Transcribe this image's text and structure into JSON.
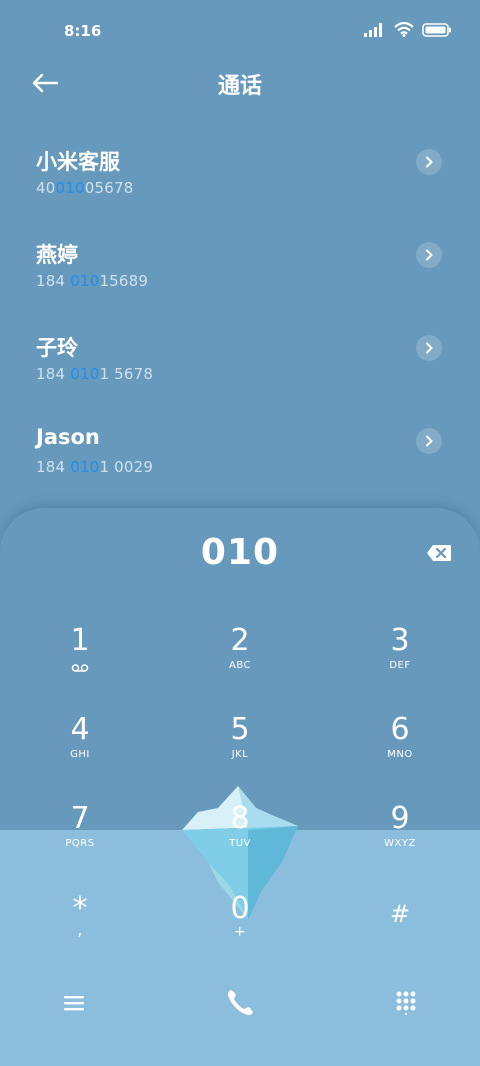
{
  "status": {
    "time": "8:16"
  },
  "header": {
    "title": "通话"
  },
  "contacts": [
    {
      "name": "小米客服",
      "num_pre": "40",
      "num_hl": "010",
      "num_post": "05678"
    },
    {
      "name": "燕婷",
      "num_pre": "184 ",
      "num_hl": "010",
      "num_post": "15689"
    },
    {
      "name": "子玲",
      "num_pre": "184 ",
      "num_hl": "010",
      "num_post": "1 5678"
    },
    {
      "name": "Jason",
      "num_pre": "184 ",
      "num_hl": "010",
      "num_post": "1 0029"
    }
  ],
  "dialpad": {
    "input": "010",
    "keys": [
      {
        "digit": "1",
        "letters": ""
      },
      {
        "digit": "2",
        "letters": "ABC"
      },
      {
        "digit": "3",
        "letters": "DEF"
      },
      {
        "digit": "4",
        "letters": "GHI"
      },
      {
        "digit": "5",
        "letters": "JKL"
      },
      {
        "digit": "6",
        "letters": "MNO"
      },
      {
        "digit": "7",
        "letters": "PQRS"
      },
      {
        "digit": "8",
        "letters": "TUV"
      },
      {
        "digit": "9",
        "letters": "WXYZ"
      },
      {
        "digit": "*",
        "letters": ","
      },
      {
        "digit": "0",
        "letters": "+"
      },
      {
        "digit": "#",
        "letters": ""
      }
    ]
  },
  "colors": {
    "background": "#6699bb",
    "lower_panel": "#8bbddd",
    "highlight": "#1d8ff0"
  }
}
